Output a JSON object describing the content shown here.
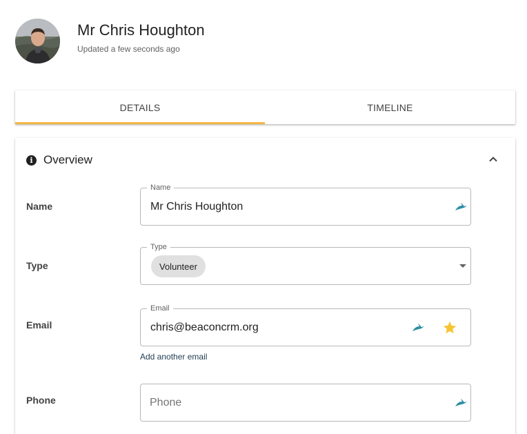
{
  "header": {
    "name": "Mr Chris Houghton",
    "updated": "Updated a few seconds ago"
  },
  "tabs": [
    {
      "label": "DETAILS",
      "active": true
    },
    {
      "label": "TIMELINE",
      "active": false
    }
  ],
  "overview": {
    "title": "Overview",
    "fields": {
      "name": {
        "label": "Name",
        "legend": "Name",
        "value": "Mr Chris Houghton"
      },
      "type": {
        "label": "Type",
        "legend": "Type",
        "chip": "Volunteer"
      },
      "email": {
        "label": "Email",
        "legend": "Email",
        "value": "chris@beaconcrm.org",
        "add_link": "Add another email"
      },
      "phone": {
        "label": "Phone",
        "placeholder": "Phone"
      }
    }
  },
  "colors": {
    "accent": "#f5b845",
    "bird_icon": "#2d8ea3",
    "star": "#f7c431",
    "link": "#1f3b50"
  }
}
